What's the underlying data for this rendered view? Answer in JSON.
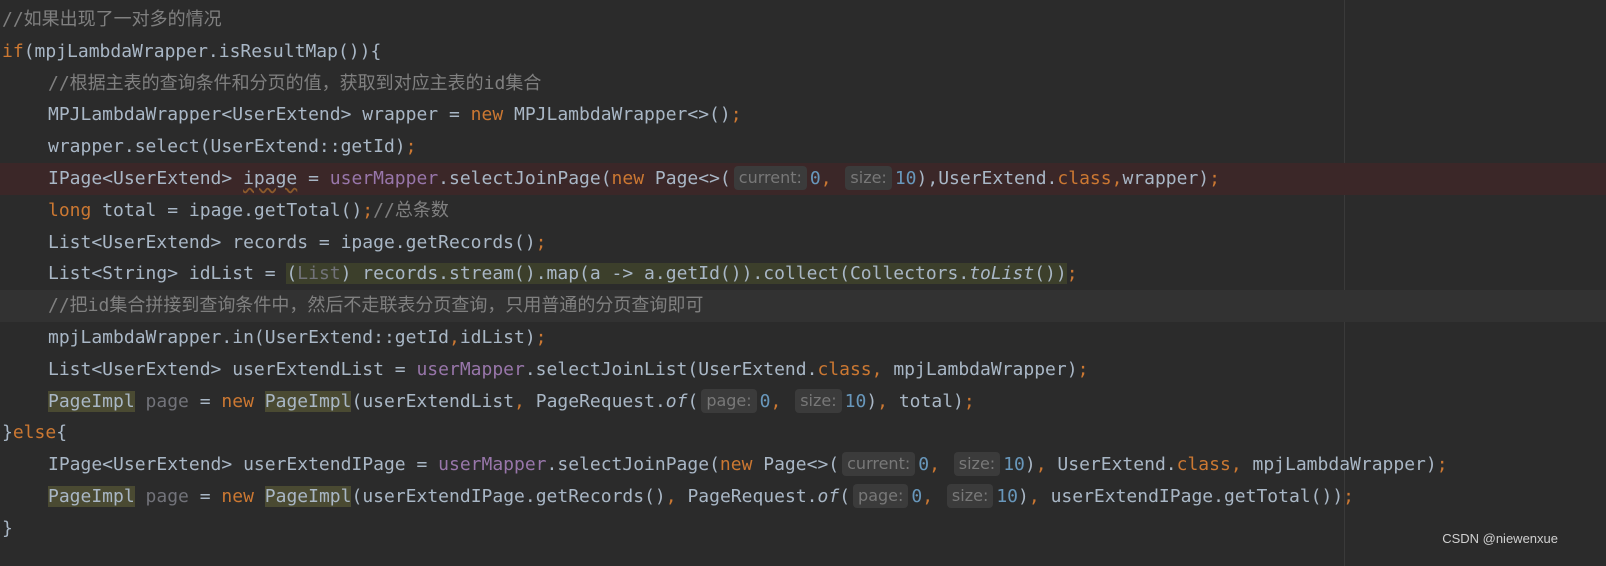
{
  "lines": [
    {
      "indent": 0,
      "tokens": [
        {
          "t": "//如果出现了一对多的情况",
          "c": "cm"
        }
      ]
    },
    {
      "indent": 0,
      "tokens": [
        {
          "t": "if",
          "c": "kw"
        },
        {
          "t": "(mpjLambdaWrapper.isResultMap()){"
        }
      ]
    },
    {
      "indent": 4,
      "tokens": [
        {
          "t": "//根据主表的查询条件和分页的值，获取到对应主表的id集合",
          "c": "cm"
        }
      ]
    },
    {
      "indent": 4,
      "tokens": [
        {
          "t": "MPJLambdaWrapper<UserExtend> wrapper = "
        },
        {
          "t": "new",
          "c": "kw"
        },
        {
          "t": " MPJLambdaWrapper<>()"
        },
        {
          "t": ";",
          "c": "kw"
        }
      ]
    },
    {
      "indent": 4,
      "tokens": [
        {
          "t": "wrapper.select(UserExtend::getId)"
        },
        {
          "t": ";",
          "c": "kw"
        }
      ]
    },
    {
      "indent": 4,
      "bg": "err",
      "tokens": [
        {
          "t": "IPage<UserExtend> "
        },
        {
          "t": "ipage",
          "c": "squig"
        },
        {
          "t": " = "
        },
        {
          "t": "userMapper",
          "c": "fld"
        },
        {
          "t": ".selectJoinPage("
        },
        {
          "t": "new",
          "c": "kw"
        },
        {
          "t": " Page<>("
        },
        {
          "t": "current:",
          "c": "hint"
        },
        {
          "t": "0",
          "c": "num"
        },
        {
          "t": ", ",
          "c": "kw"
        },
        {
          "t": "size:",
          "c": "hint"
        },
        {
          "t": "10",
          "c": "num"
        },
        {
          "t": "),UserExtend."
        },
        {
          "t": "class",
          "c": "kw"
        },
        {
          "t": ",",
          "c": "kw"
        },
        {
          "t": "wrapper)"
        },
        {
          "t": ";",
          "c": "kw"
        }
      ]
    },
    {
      "indent": 4,
      "tokens": [
        {
          "t": "long",
          "c": "kw"
        },
        {
          "t": " total = ipage.getTotal()"
        },
        {
          "t": ";",
          "c": "kw"
        },
        {
          "t": "//总条数",
          "c": "cm"
        }
      ]
    },
    {
      "indent": 4,
      "tokens": [
        {
          "t": "List<UserExtend> records = ipage.getRecords()"
        },
        {
          "t": ";",
          "c": "kw"
        }
      ]
    },
    {
      "indent": 4,
      "tokens": [
        {
          "t": "List<String> idList = "
        },
        {
          "t": "(",
          "c": "hl"
        },
        {
          "t": "List",
          "c": "hl unused"
        },
        {
          "t": ") records.stream().map(a -> a.getId()).collect(Collectors.",
          "c": "hl"
        },
        {
          "t": "toList",
          "c": "hl ital"
        },
        {
          "t": "())",
          "c": "hl"
        },
        {
          "t": ";",
          "c": "kw"
        }
      ]
    },
    {
      "indent": 4,
      "bg": "cur",
      "tokens": [
        {
          "t": "//把id集合拼接到查询条件中，然后不走联表分页查询，只用普通的分页查询即可",
          "c": "cm"
        }
      ]
    },
    {
      "indent": 4,
      "tokens": [
        {
          "t": "mpjLambdaWrapper.in(UserExtend::getId"
        },
        {
          "t": ",",
          "c": "kw"
        },
        {
          "t": "idList)"
        },
        {
          "t": ";",
          "c": "kw"
        }
      ]
    },
    {
      "indent": 4,
      "tokens": [
        {
          "t": "List<UserExtend> userExtendList = "
        },
        {
          "t": "userMapper",
          "c": "fld"
        },
        {
          "t": ".selectJoinList(UserExtend."
        },
        {
          "t": "class",
          "c": "kw"
        },
        {
          "t": ", ",
          "c": "kw"
        },
        {
          "t": "mpjLambdaWrapper)"
        },
        {
          "t": ";",
          "c": "kw"
        }
      ]
    },
    {
      "indent": 4,
      "tokens": [
        {
          "t": "PageImpl",
          "c": "hlc"
        },
        {
          "t": " "
        },
        {
          "t": "page",
          "c": "unused"
        },
        {
          "t": " = "
        },
        {
          "t": "new",
          "c": "kw"
        },
        {
          "t": " "
        },
        {
          "t": "PageImpl",
          "c": "hlc"
        },
        {
          "t": "(userExtendList"
        },
        {
          "t": ", ",
          "c": "kw"
        },
        {
          "t": "PageRequest."
        },
        {
          "t": "of",
          "c": "ital"
        },
        {
          "t": "("
        },
        {
          "t": "page:",
          "c": "hint"
        },
        {
          "t": "0",
          "c": "num"
        },
        {
          "t": ", ",
          "c": "kw"
        },
        {
          "t": "size:",
          "c": "hint"
        },
        {
          "t": "10",
          "c": "num"
        },
        {
          "t": ")"
        },
        {
          "t": ", ",
          "c": "kw"
        },
        {
          "t": "total)"
        },
        {
          "t": ";",
          "c": "kw"
        }
      ]
    },
    {
      "indent": 0,
      "tokens": [
        {
          "t": "}"
        },
        {
          "t": "else",
          "c": "kw"
        },
        {
          "t": "{"
        }
      ]
    },
    {
      "indent": 4,
      "tokens": [
        {
          "t": "IPage<UserExtend> userExtendIPage = "
        },
        {
          "t": "userMapper",
          "c": "fld"
        },
        {
          "t": ".selectJoinPage("
        },
        {
          "t": "new",
          "c": "kw"
        },
        {
          "t": " Page<>("
        },
        {
          "t": "current:",
          "c": "hint"
        },
        {
          "t": "0",
          "c": "num"
        },
        {
          "t": ", ",
          "c": "kw"
        },
        {
          "t": "size:",
          "c": "hint"
        },
        {
          "t": "10",
          "c": "num"
        },
        {
          "t": ")"
        },
        {
          "t": ", ",
          "c": "kw"
        },
        {
          "t": "UserExtend."
        },
        {
          "t": "class",
          "c": "kw"
        },
        {
          "t": ", ",
          "c": "kw"
        },
        {
          "t": "mpjLambdaWrapper)"
        },
        {
          "t": ";",
          "c": "kw"
        }
      ]
    },
    {
      "indent": 4,
      "tokens": [
        {
          "t": "PageImpl",
          "c": "hlc"
        },
        {
          "t": " "
        },
        {
          "t": "page",
          "c": "unused"
        },
        {
          "t": " = "
        },
        {
          "t": "new",
          "c": "kw"
        },
        {
          "t": " "
        },
        {
          "t": "PageImpl",
          "c": "hlc"
        },
        {
          "t": "(userExtendIPage.getRecords()"
        },
        {
          "t": ", ",
          "c": "kw"
        },
        {
          "t": "PageRequest."
        },
        {
          "t": "of",
          "c": "ital"
        },
        {
          "t": "("
        },
        {
          "t": "page:",
          "c": "hint"
        },
        {
          "t": "0",
          "c": "num"
        },
        {
          "t": ", ",
          "c": "kw"
        },
        {
          "t": "size:",
          "c": "hint"
        },
        {
          "t": "10",
          "c": "num"
        },
        {
          "t": ")"
        },
        {
          "t": ", ",
          "c": "kw"
        },
        {
          "t": "userExtendIPage.getTotal())"
        },
        {
          "t": ";",
          "c": "kw"
        }
      ]
    },
    {
      "indent": 0,
      "tokens": [
        {
          "t": "}"
        }
      ]
    }
  ],
  "watermark": "CSDN @niewenxue",
  "colors": {
    "background": "#2b2b2b",
    "text": "#a9b7c6",
    "keyword": "#cc7832",
    "comment": "#808080",
    "field": "#9876aa",
    "number": "#6897bb"
  }
}
